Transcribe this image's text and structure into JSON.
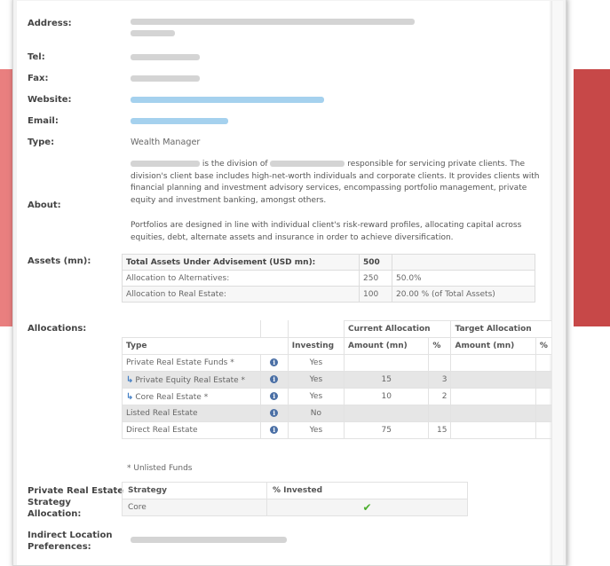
{
  "fields": {
    "address_label": "Address:",
    "tel_label": "Tel:",
    "fax_label": "Fax:",
    "website_label": "Website:",
    "email_label": "Email:",
    "type_label": "Type:",
    "type_value": "Wealth Manager",
    "about_label": "About:",
    "assets_label": "Assets (mn):",
    "allocations_label": "Allocations:",
    "strategy_label": "Private Real Estate Strategy Allocation:",
    "indirect_label": "Indirect Location Preferences:"
  },
  "about": {
    "p1_a": "is the division of",
    "p1_b": "responsible for servicing private clients. The division's client base includes high-net-worth individuals and corporate clients. It provides clients with financial planning and investment advisory services, encompassing portfolio management, private equity and investment banking, amongst others.",
    "p2": "Portfolios are designed in line with individual client's risk-reward profiles, allocating capital across equities, debt, alternate assets and insurance in order to achieve diversification."
  },
  "assets": {
    "rows": [
      {
        "label": "Total Assets Under Advisement (USD mn):",
        "value": "500",
        "extra": ""
      },
      {
        "label": "Allocation to Alternatives:",
        "value": "250",
        "extra": "50.0%"
      },
      {
        "label": "Allocation to Real Estate:",
        "value": "100",
        "extra": "20.00 % (of Total Assets)"
      }
    ]
  },
  "allocations": {
    "group_current": "Current Allocation",
    "group_target": "Target Allocation",
    "headers": {
      "type": "Type",
      "investing": "Investing",
      "amount_current": "Amount (mn)",
      "pct_current": "%",
      "amount_target": "Amount (mn)",
      "pct_target": "%"
    },
    "rows": [
      {
        "type": "Private Real Estate Funds *",
        "investing": "Yes",
        "amount": "",
        "pct": ""
      },
      {
        "type": "Private Equity Real Estate *",
        "investing": "Yes",
        "amount": "15",
        "pct": "3"
      },
      {
        "type": "Core Real Estate *",
        "investing": "Yes",
        "amount": "10",
        "pct": "2"
      },
      {
        "type": "Listed Real Estate",
        "investing": "No",
        "amount": "",
        "pct": ""
      },
      {
        "type": "Direct Real Estate",
        "investing": "Yes",
        "amount": "75",
        "pct": "15"
      }
    ],
    "footnote": "* Unlisted Funds"
  },
  "strategy": {
    "header_strategy": "Strategy",
    "header_invested": "% Invested",
    "row_strategy": "Core"
  },
  "icons": {
    "info": "info-icon",
    "child": "child-arrow-icon",
    "check": "checkmark-icon"
  },
  "colors": {
    "link": "#3a9ad9",
    "check": "#4caf2e",
    "info": "#4a6fa5",
    "accent_red": "#c74848"
  }
}
